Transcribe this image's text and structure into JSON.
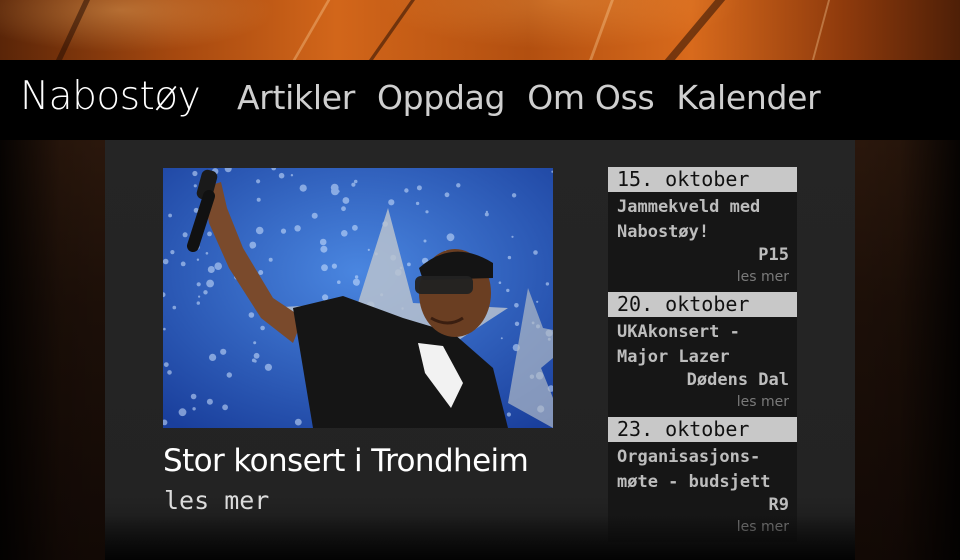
{
  "header": {
    "brand": "Nabostøy",
    "menu": [
      "Artikler",
      "Oppdag",
      "Om Oss",
      "Kalender"
    ]
  },
  "feature": {
    "title": "Stor konsert i Trondheim",
    "more": "les mer"
  },
  "events": [
    {
      "date": "15. oktober",
      "title": "Jammekveld med Nabostøy!",
      "place": "P15",
      "more": "les mer"
    },
    {
      "date": "20. oktober",
      "title": "UKAkonsert - Major Lazer",
      "place": "Dødens Dal",
      "more": "les mer"
    },
    {
      "date": "23. oktober",
      "title": "Organisasjons-møte - budsjett",
      "place": "R9",
      "more": "les mer"
    }
  ],
  "colors": {
    "nav_bg": "#000000",
    "panel_bg": "#252525",
    "date_bar": "#c8c8c8",
    "banner_wood": "#c8601a"
  }
}
